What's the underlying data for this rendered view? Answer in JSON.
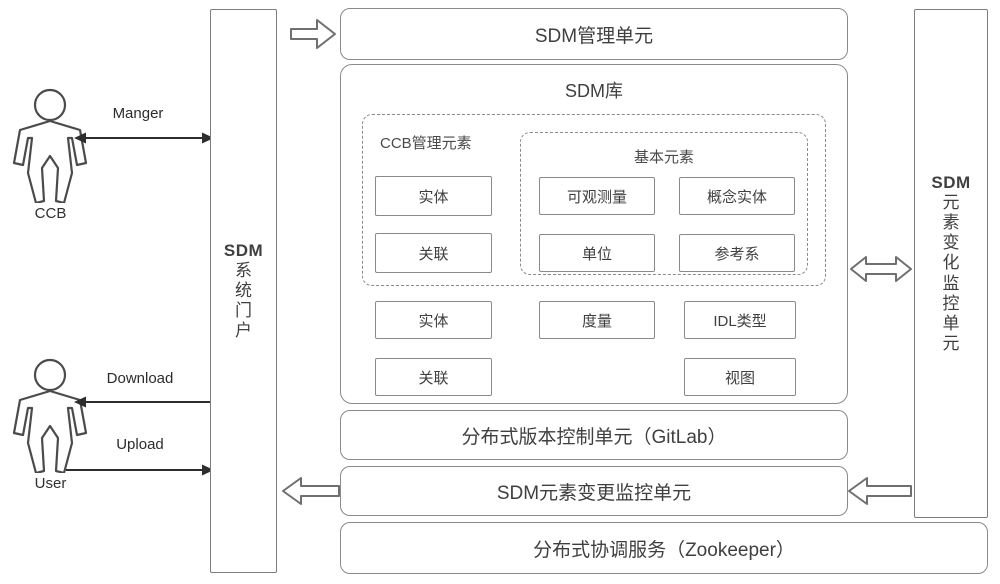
{
  "diagram": {
    "title": "SDM system architecture diagram",
    "accent_border": "#8a8a8a",
    "background": "#ffffff"
  },
  "actors": [
    {
      "id": "ccb",
      "label": "CCB",
      "icon": "person-icon"
    },
    {
      "id": "user",
      "label": "User",
      "icon": "person-icon"
    }
  ],
  "connections": [
    {
      "id": "manger",
      "label": "Manger",
      "direction": "bidirectional",
      "from": "CCB",
      "to": "SDM系统门户"
    },
    {
      "id": "download",
      "label": "Download",
      "direction": "left",
      "from": "SDM系统门户",
      "to": "User"
    },
    {
      "id": "upload",
      "label": "Upload",
      "direction": "right",
      "from": "User",
      "to": "SDM系统门户"
    }
  ],
  "block_arrows": [
    {
      "id": "portal-to-management",
      "direction": "right",
      "icon": "block-arrow-right-icon"
    },
    {
      "id": "library-to-monitor",
      "direction": "bidirectional",
      "icon": "block-arrow-both-icon"
    },
    {
      "id": "monitor-to-change",
      "direction": "left",
      "icon": "block-arrow-left-icon"
    },
    {
      "id": "change-to-portal",
      "direction": "left",
      "icon": "block-arrow-left-icon"
    }
  ],
  "portal": {
    "name": "sdm-system-portal",
    "lines": [
      "SDM",
      "系",
      "统",
      "门",
      "户"
    ]
  },
  "monitor_column": {
    "name": "sdm-element-change-monitor-unit",
    "lines": [
      "SDM",
      "元",
      "素",
      "变",
      "化",
      "监",
      "控",
      "单",
      "元"
    ]
  },
  "management_unit": {
    "label": "SDM管理单元"
  },
  "library": {
    "label": "SDM库",
    "ccb_group": {
      "label": "CCB管理元素",
      "items": [
        {
          "label": "实体"
        },
        {
          "label": "关联"
        }
      ]
    },
    "basic_group": {
      "label": "基本元素",
      "items": [
        {
          "label": "可观测量"
        },
        {
          "label": "概念实体"
        },
        {
          "label": "单位"
        },
        {
          "label": "参考系"
        }
      ]
    },
    "free_items": [
      {
        "label": "实体"
      },
      {
        "label": "度量"
      },
      {
        "label": "IDL类型"
      },
      {
        "label": "关联"
      },
      {
        "label": "视图"
      }
    ]
  },
  "bottom_bars": [
    {
      "id": "version-control",
      "label": "分布式版本控制单元（GitLab）"
    },
    {
      "id": "change-monitor",
      "label": "SDM元素变更监控单元"
    },
    {
      "id": "coordination",
      "label": "分布式协调服务（Zookeeper）"
    }
  ]
}
